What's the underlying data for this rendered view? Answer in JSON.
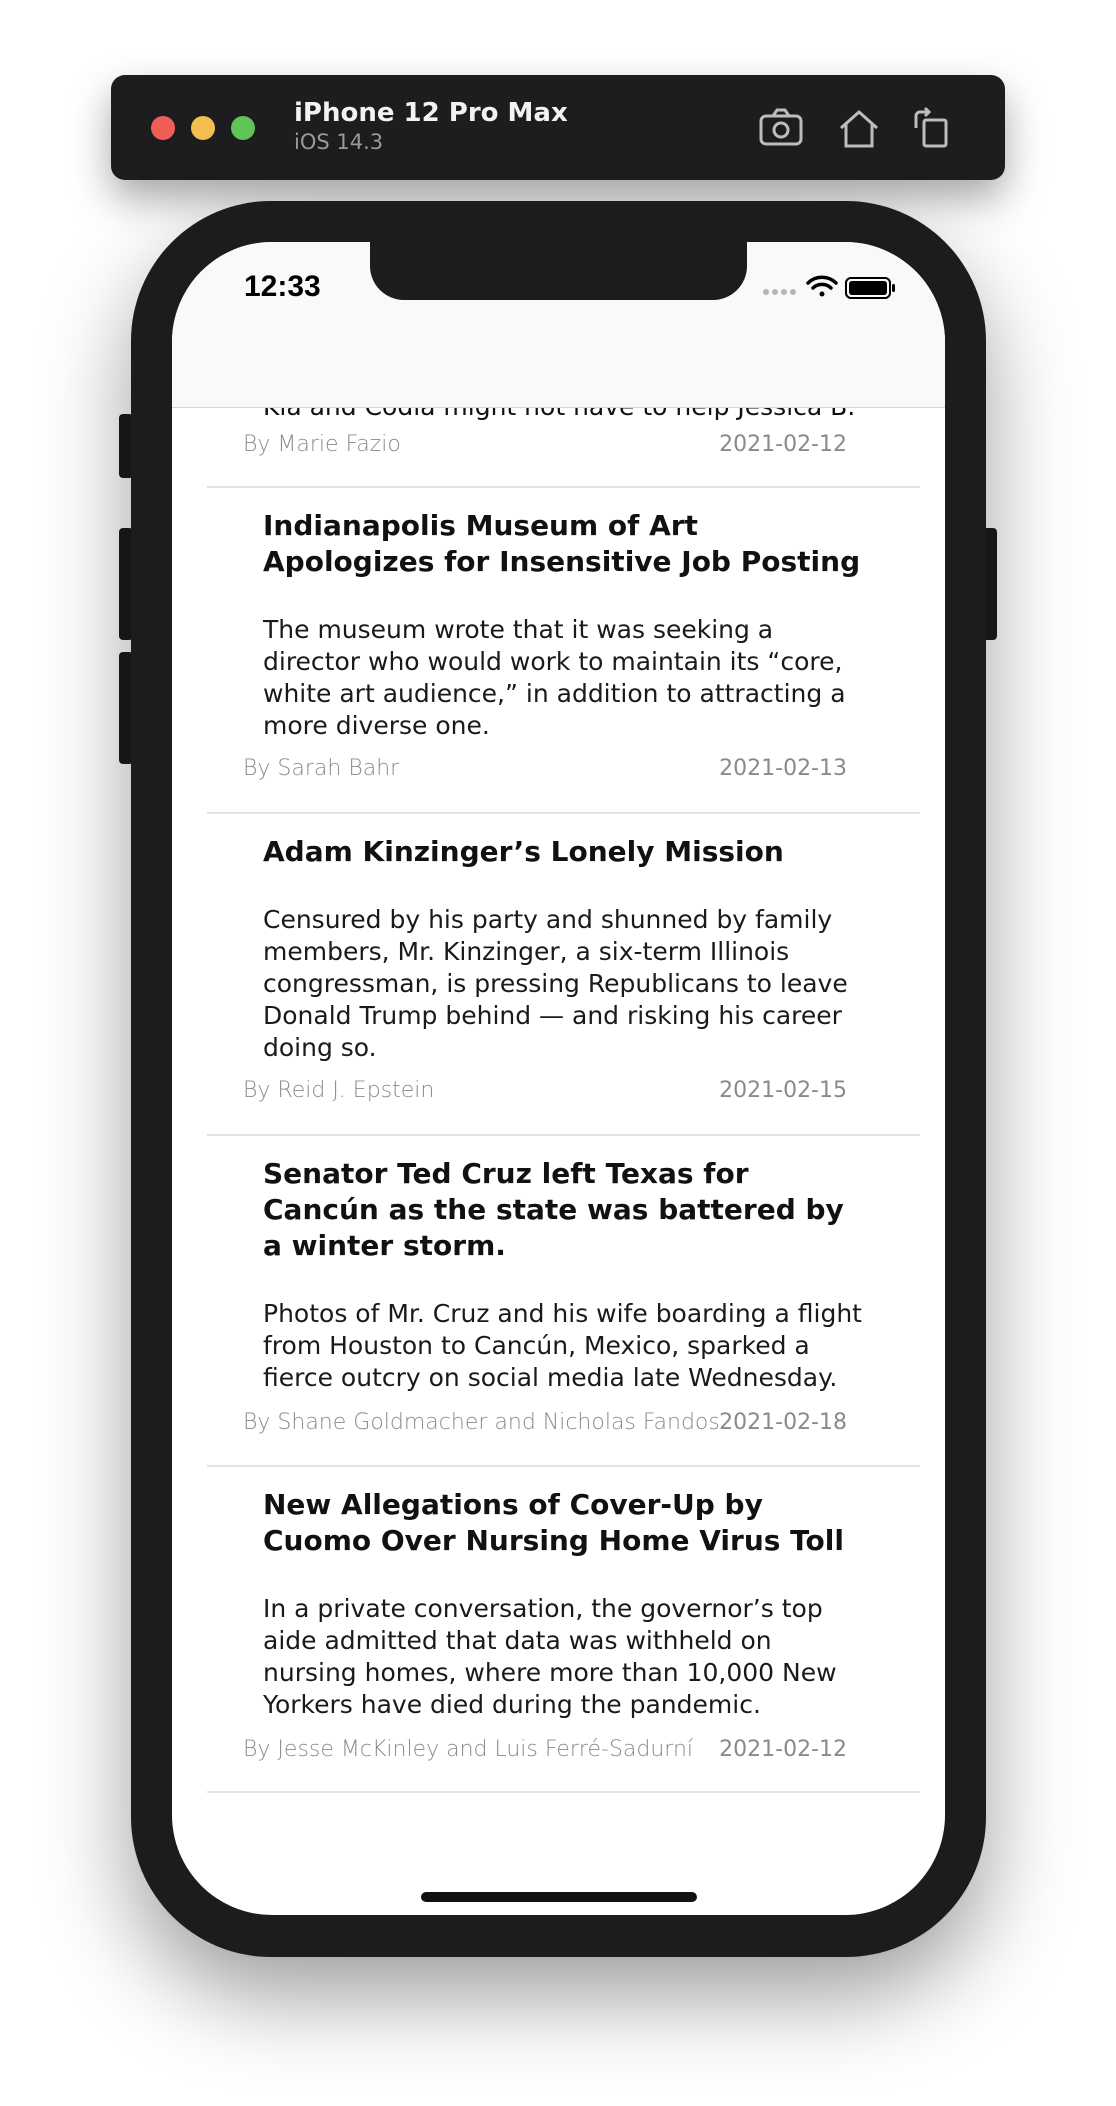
{
  "simulator": {
    "device_name": "iPhone 12 Pro Max",
    "os_version": "iOS 14.3"
  },
  "status_bar": {
    "time": "12:33"
  },
  "clipped_text": "Kia and Codia might not have to help Jessica B.",
  "first_row": {
    "author": "By Marie Fazio",
    "date": "2021-02-12"
  },
  "articles": [
    {
      "title": "Indianapolis Museum of Art Apologizes for Insensitive Job Posting",
      "summary": "The museum wrote that it was seeking a director who would work to maintain its “core, white art audience,” in addition to attracting a more diverse one.",
      "author": "By Sarah Bahr",
      "date": "2021-02-13"
    },
    {
      "title": "Adam Kinzinger’s Lonely Mission",
      "summary": "Censured by his party and shunned by family members, Mr. Kinzinger, a six-term Illinois congressman, is pressing Republicans to leave Donald Trump behind — and risking his career doing so.",
      "author": "By Reid J. Epstein",
      "date": "2021-02-15"
    },
    {
      "title": "Senator Ted Cruz left Texas for Cancún as the state was battered by a winter storm.",
      "summary": "Photos of Mr. Cruz and his wife boarding a flight from Houston to Cancún, Mexico, sparked a fierce outcry on social media late Wednesday.",
      "author": "By Shane Goldmacher and Nicholas Fandos",
      "date": "2021-02-18"
    },
    {
      "title": "New Allegations of Cover-Up by Cuomo Over Nursing Home Virus Toll",
      "summary": "In a private conversation, the governor’s top aide admitted that data was withheld on nursing homes, where more than 10,000 New Yorkers have died during the pandemic.",
      "author": "By Jesse McKinley and Luis Ferré-Sadurní",
      "date": "2021-02-12"
    }
  ]
}
